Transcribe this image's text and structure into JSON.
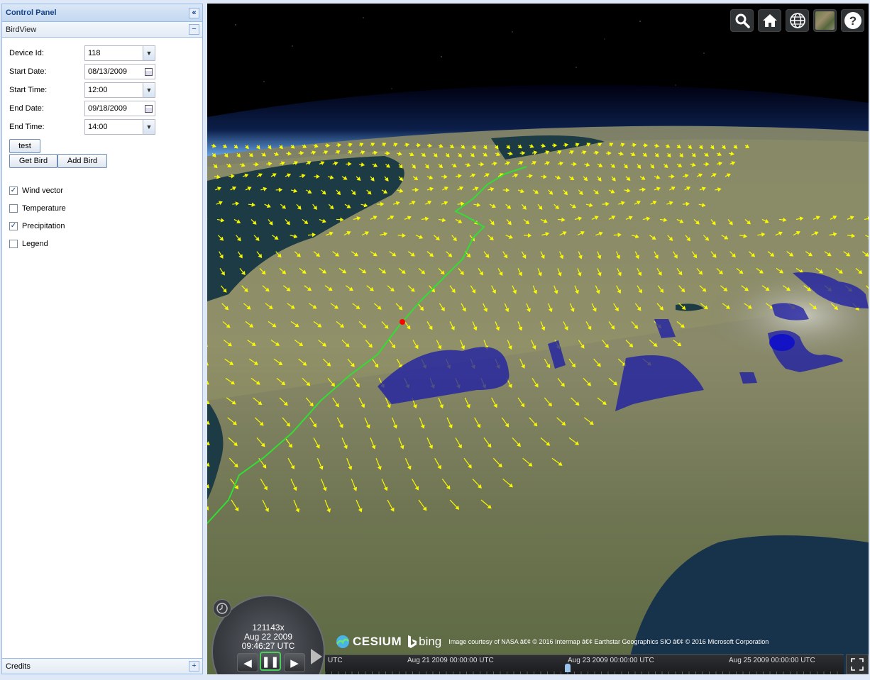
{
  "control_panel": {
    "title": "Control Panel",
    "collapse_icon": "double-chevron-left-icon",
    "birdview": {
      "title": "BirdView",
      "collapse_icon": "minus-icon",
      "fields": {
        "device_id": {
          "label": "Device Id:",
          "value": "118"
        },
        "start_date": {
          "label": "Start Date:",
          "value": "08/13/2009"
        },
        "start_time": {
          "label": "Start Time:",
          "value": "12:00"
        },
        "end_date": {
          "label": "End Date:",
          "value": "09/18/2009"
        },
        "end_time": {
          "label": "End Time:",
          "value": "14:00"
        }
      },
      "buttons": {
        "test": "test",
        "get_bird": "Get Bird",
        "add_bird": "Add Bird"
      },
      "layers": [
        {
          "label": "Wind vector",
          "checked": true
        },
        {
          "label": "Temperature",
          "checked": false
        },
        {
          "label": "Precipitation",
          "checked": true
        },
        {
          "label": "Legend",
          "checked": false
        }
      ]
    },
    "credits": {
      "title": "Credits",
      "expand_icon": "plus-icon"
    }
  },
  "viewer": {
    "toolbar": [
      "search-icon",
      "home-icon",
      "globe-icon",
      "imagery-icon",
      "help-icon"
    ],
    "animation": {
      "speed": "121143x",
      "date": "Aug 22 2009",
      "time": "09:46:27 UTC"
    },
    "logos": {
      "cesium": "CESIUM",
      "bing": "bing",
      "attribution": "Image courtesy of NASA â€¢ © 2016 Intermap â€¢ Earthstar Geographics SIO â€¢ © 2016 Microsoft Corporation"
    },
    "timeline": {
      "labels": [
        "UTC",
        "Aug 21 2009 00:00:00 UTC",
        "Aug 23 2009 00:00:00 UTC",
        "Aug 25 2009 00:00:00 UTC"
      ]
    },
    "colors": {
      "wind_vector": "#ffff00",
      "precipitation": "#1a1aa8",
      "bird_track": "#33dd33",
      "bird_position": "#ff0000"
    }
  }
}
